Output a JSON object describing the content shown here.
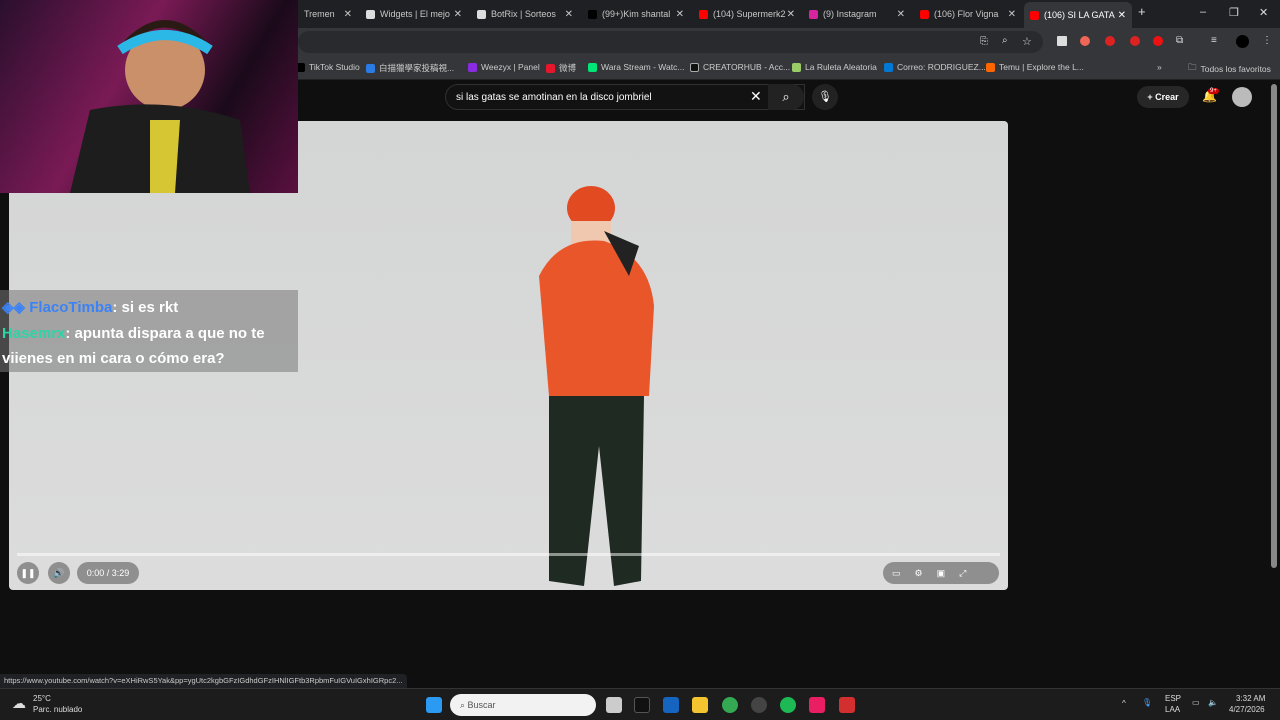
{
  "tabs": [
    {
      "label": "Tremen",
      "color": "#888"
    },
    {
      "label": "Widgets | El mejo",
      "color": "#ddd"
    },
    {
      "label": "BotRix | Sorteos",
      "color": "#ddd"
    },
    {
      "label": "(99+)Kim shantal",
      "color": "#000"
    },
    {
      "label": "(104) Supermerk2",
      "color": "#f00"
    },
    {
      "label": "(9) Instagram",
      "color": "#d6249f"
    },
    {
      "label": "(106) Flor Vigna",
      "color": "#f00"
    },
    {
      "label": "(106) SI LA GATA",
      "color": "#f00"
    }
  ],
  "bookmarks": [
    {
      "label": "TikTok Studio",
      "color": "#000"
    },
    {
      "label": "白描獵學家投稿視...",
      "color": "#2a7be4"
    },
    {
      "label": "Weezyx | Panel",
      "color": "#8a2be2"
    },
    {
      "label": "微博",
      "color": "#e6162d"
    },
    {
      "label": "Wara Stream - Watc...",
      "color": "#00e676"
    },
    {
      "label": "CREATORHUB - Acc...",
      "color": "#111"
    },
    {
      "label": "La Ruleta Aleatoria",
      "color": "#9c6"
    },
    {
      "label": "Correo: RODRIGUEZ...",
      "color": "#0078d4"
    },
    {
      "label": "Temu | Explore the L...",
      "color": "#f60"
    }
  ],
  "all_bookmarks": "Todos los favoritos",
  "more_bookmarks": "»",
  "search": {
    "query": "si las gatas se amotinan en la disco jombriel"
  },
  "header": {
    "create": "Crear",
    "notifications": "9+"
  },
  "player": {
    "time": "0:00 / 3:29",
    "progress": 0
  },
  "chat": [
    {
      "user": "FlacoTimba",
      "message": ": si es rkt",
      "color": "#3b82f6"
    },
    {
      "user": "Hasemrx",
      "message": ": apunta dispara a que no te viienes en mi cara o cómo era?",
      "color": "#2dd4a6"
    }
  ],
  "status_url": "https://www.youtube.com/watch?v=eXHiRwS5Yak&pp=ygUtc2kgbGFzIGdhdGFzIHNlIGFtb3RpbmFuIGVuIGxhIGRpc2...",
  "taskbar": {
    "weather_temp": "25°C",
    "weather_desc": "Parc. nublado",
    "search": "Buscar",
    "lang": "ESP",
    "lang2": "LAA",
    "time": "3:32 AM",
    "date": "4/27/2026"
  }
}
